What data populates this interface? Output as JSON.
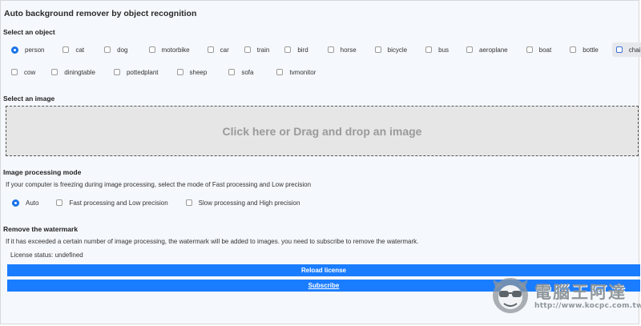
{
  "app": {
    "title": "Auto background remover by object recognition"
  },
  "objects": {
    "heading": "Select an object",
    "row1": [
      {
        "label": "person",
        "selected": true
      },
      {
        "label": "cat"
      },
      {
        "label": "dog"
      },
      {
        "label": "motorbike"
      },
      {
        "label": "car"
      },
      {
        "label": "train"
      },
      {
        "label": "bird"
      },
      {
        "label": "horse"
      },
      {
        "label": "bicycle"
      },
      {
        "label": "bus"
      },
      {
        "label": "aeroplane"
      },
      {
        "label": "boat"
      },
      {
        "label": "bottle"
      },
      {
        "label": "chair",
        "hovered": true
      }
    ],
    "row2": [
      {
        "label": "cow"
      },
      {
        "label": "diningtable"
      },
      {
        "label": "pottedplant"
      },
      {
        "label": "sheep"
      },
      {
        "label": "sofa"
      },
      {
        "label": "tvmonitor"
      }
    ]
  },
  "image": {
    "heading": "Select an image",
    "dropzone_text": "Click here or Drag and drop an image"
  },
  "processing": {
    "heading": "Image processing mode",
    "description": "If your computer is freezing during image processing, select the mode of Fast processing and Low precision",
    "modes": [
      {
        "label": "Auto",
        "selected": true
      },
      {
        "label": "Fast processing and Low precision"
      },
      {
        "label": "Slow processing and High precision"
      }
    ]
  },
  "watermark": {
    "heading": "Remove the watermark",
    "description": "If it has exceeded a certain number of image processing, the watermark will be added to images. you need to subscribe to remove the watermark.",
    "license_status": "License status: undefined",
    "reload_label": "Reload license",
    "subscribe_label": "Subscribe"
  },
  "overlay": {
    "brand": "電腦王阿達",
    "url": "http://www.kocpc.com.tw"
  },
  "colors": {
    "accent": "#1a7cff",
    "radio": "#1a73e8"
  }
}
